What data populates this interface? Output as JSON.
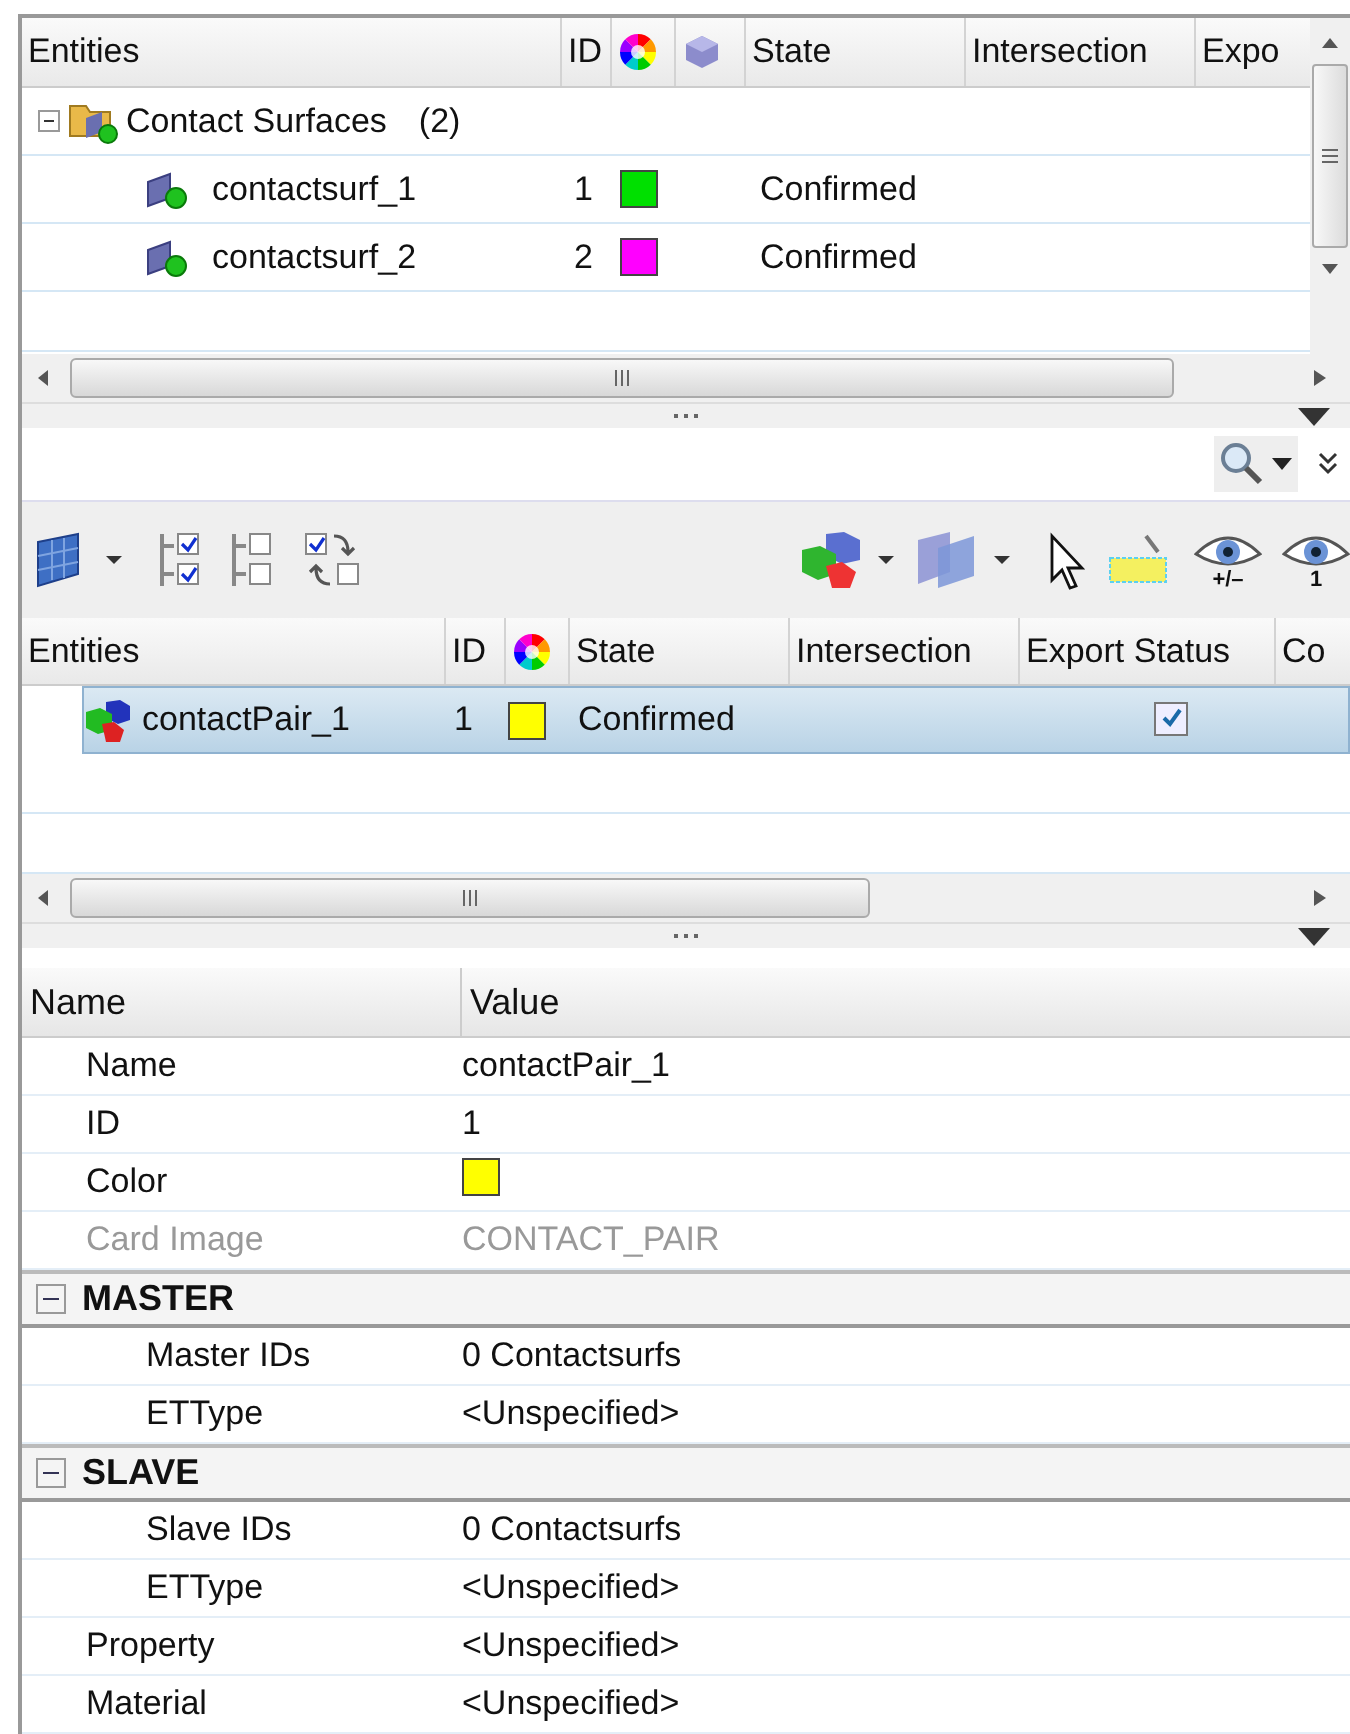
{
  "top_table": {
    "columns": [
      "Entities",
      "ID",
      "",
      "",
      "State",
      "Intersection",
      "Expo"
    ],
    "tree": [
      {
        "name": "Contact Surfaces",
        "count": "(2)",
        "expanded": true,
        "children": [
          {
            "name": "contactsurf_1",
            "id": "1",
            "color": "#00e000",
            "state": "Confirmed"
          },
          {
            "name": "contactsurf_2",
            "id": "2",
            "color": "#ff00ff",
            "state": "Confirmed"
          }
        ]
      }
    ]
  },
  "toolbar": {
    "eye_buttons": [
      {
        "label": "+/–"
      },
      {
        "label": "1"
      }
    ]
  },
  "pair_table": {
    "columns": [
      "Entities",
      "ID",
      "",
      "State",
      "Intersection",
      "Export Status",
      "Co"
    ],
    "rows": [
      {
        "name": "contactPair_1",
        "id": "1",
        "color": "#ffff00",
        "state": "Confirmed",
        "export": true,
        "selected": true
      }
    ]
  },
  "properties": {
    "columns": [
      "Name",
      "Value"
    ],
    "items": [
      {
        "kind": "text",
        "name": "Name",
        "value": "contactPair_1",
        "disabled": false
      },
      {
        "kind": "text",
        "name": "ID",
        "value": "1",
        "disabled": false
      },
      {
        "kind": "color",
        "name": "Color",
        "color": "#ffff00",
        "disabled": false
      },
      {
        "kind": "text",
        "name": "Card Image",
        "value": "CONTACT_PAIR",
        "disabled": true
      },
      {
        "kind": "group",
        "name": "MASTER",
        "expanded": true,
        "children": [
          {
            "kind": "text",
            "name": "Master IDs",
            "value": "0 Contactsurfs",
            "disabled": false
          },
          {
            "kind": "text",
            "name": "ETType",
            "value": "<Unspecified>",
            "disabled": false
          }
        ]
      },
      {
        "kind": "group",
        "name": "SLAVE",
        "expanded": true,
        "children": [
          {
            "kind": "text",
            "name": "Slave IDs",
            "value": "0 Contactsurfs",
            "disabled": false
          },
          {
            "kind": "text",
            "name": "ETType",
            "value": "<Unspecified>",
            "disabled": false
          }
        ]
      },
      {
        "kind": "text",
        "name": "Property",
        "value": "<Unspecified>",
        "disabled": false
      },
      {
        "kind": "text",
        "name": "Material",
        "value": "<Unspecified>",
        "disabled": false
      }
    ]
  }
}
